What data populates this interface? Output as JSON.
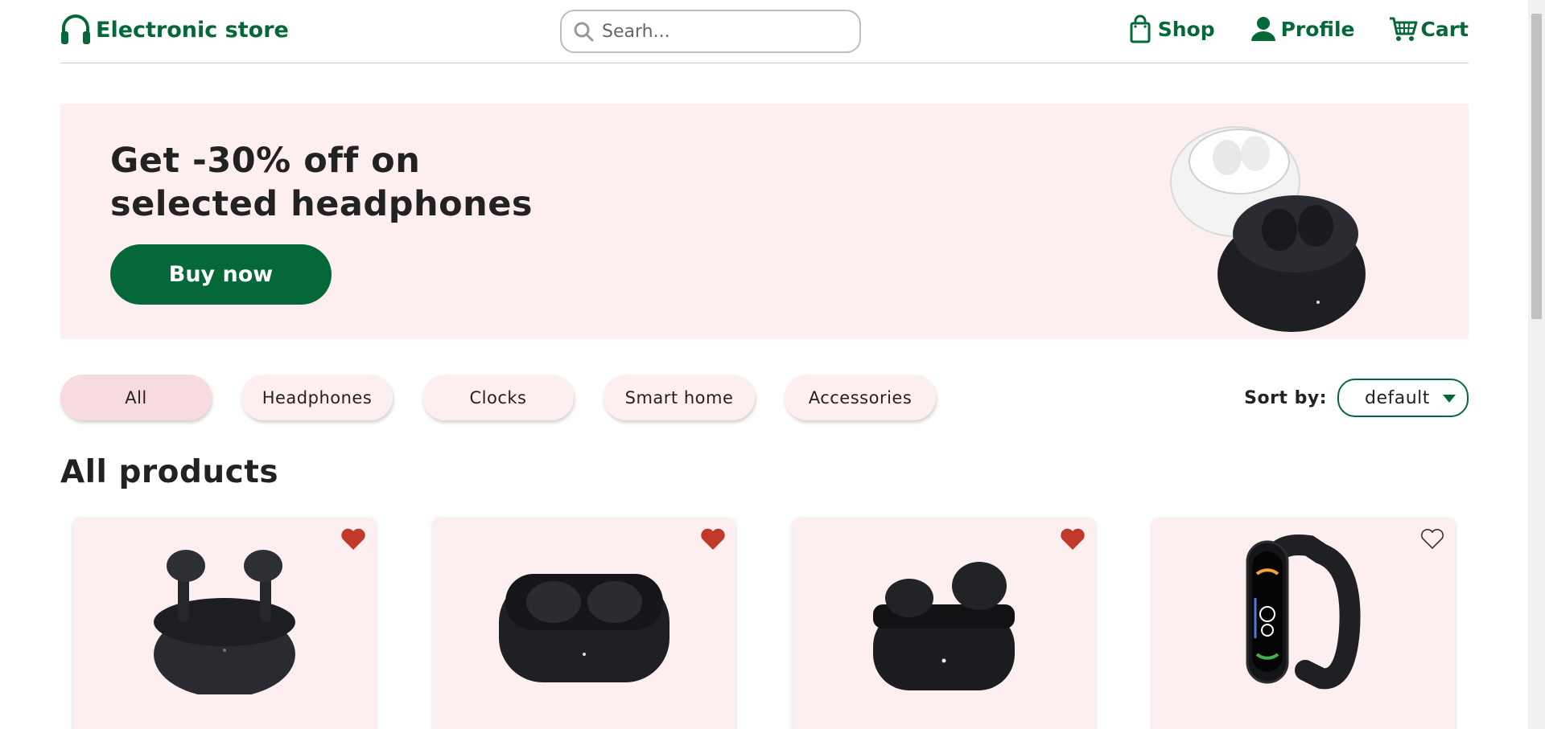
{
  "header": {
    "logo_text": "Electronic store",
    "search_placeholder": "Searh...",
    "nav": [
      {
        "label": "Shop",
        "icon": "shopping-bag-icon"
      },
      {
        "label": "Profile",
        "icon": "user-icon"
      },
      {
        "label": "Cart",
        "icon": "cart-icon"
      }
    ]
  },
  "banner": {
    "headline_line1": "Get -30% off on",
    "headline_line2": "selected headphones",
    "button_label": "Buy now"
  },
  "filters": {
    "chips": [
      "All",
      "Headphones",
      "Clocks",
      "Smart home",
      "Accessories"
    ],
    "active": "All",
    "sort_label": "Sort by:",
    "sort_value": "default"
  },
  "section_title": "All products",
  "products": [
    {
      "image": "earbuds-case-open-icon",
      "favorite": true
    },
    {
      "image": "earbuds-case-icon",
      "favorite": true
    },
    {
      "image": "earbuds-compact-icon",
      "favorite": true
    },
    {
      "image": "smart-band-icon",
      "favorite": false
    }
  ],
  "colors": {
    "brand": "#056839",
    "banner_bg": "#fdefef",
    "chip_active": "#f8dbdf",
    "heart": "#c0392b"
  }
}
